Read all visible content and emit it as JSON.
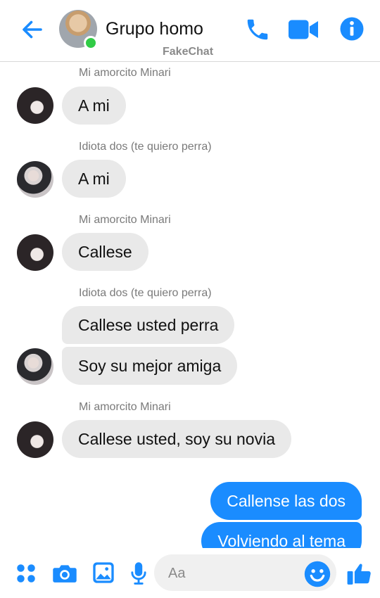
{
  "header": {
    "title": "Grupo homo",
    "watermark": "FakeChat"
  },
  "colors": {
    "accent": "#1a8cff",
    "online": "#31cc46",
    "incoming_bubble": "#e9e9e9"
  },
  "messages": [
    {
      "sender": "Mi amorcito Minari",
      "text": "A mi"
    },
    {
      "sender": "Idiota dos (te quiero perra)",
      "text": "A mi"
    },
    {
      "sender": "Mi amorcito Minari",
      "text": "Callese"
    },
    {
      "sender": "Idiota dos (te quiero perra)",
      "text": "Callese usted perra"
    },
    {
      "text": "Soy su mejor amiga"
    },
    {
      "sender": "Mi amorcito Minari",
      "text": "Callese usted, soy su novia"
    },
    {
      "text": "Callense las dos",
      "outgoing": true
    },
    {
      "text": "Volviendo al tema",
      "outgoing": true
    }
  ],
  "composer": {
    "placeholder": "Aa"
  },
  "icons": {
    "back": "arrow-left-icon",
    "call": "phone-icon",
    "video": "video-camera-icon",
    "info": "info-icon",
    "more": "four-dots-icon",
    "camera": "camera-icon",
    "gallery": "image-icon",
    "mic": "microphone-icon",
    "emoji": "smiley-icon",
    "like": "thumbs-up-icon"
  }
}
